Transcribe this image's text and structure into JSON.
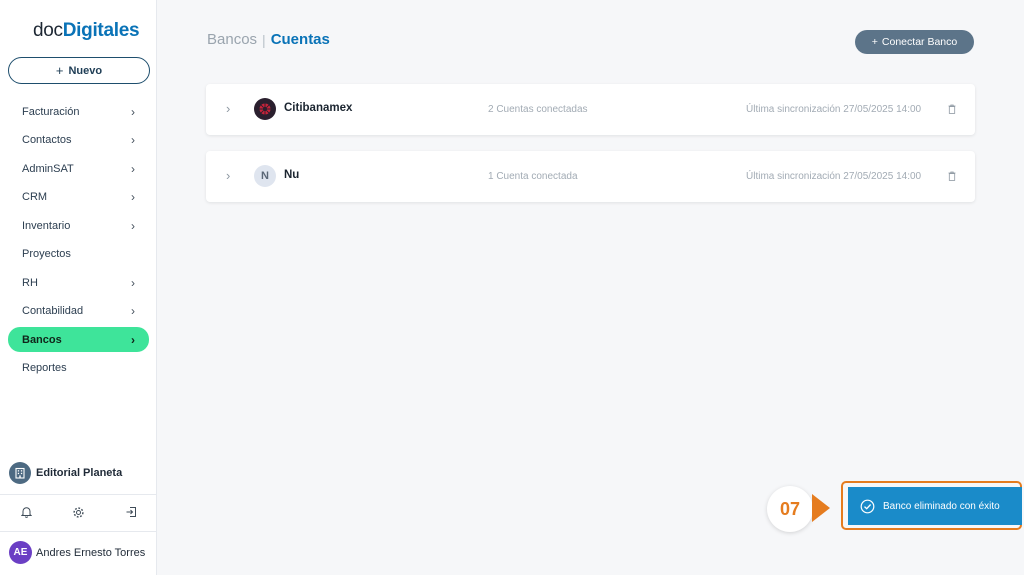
{
  "sidebar": {
    "logo": {
      "doc": "doc",
      "digitales": "Digitales"
    },
    "new_button": {
      "icon": "plus-icon",
      "label": "Nuevo"
    },
    "items": [
      {
        "label": "Facturación",
        "has_submenu": true,
        "active": false
      },
      {
        "label": "Contactos",
        "has_submenu": true,
        "active": false
      },
      {
        "label": "AdminSAT",
        "has_submenu": true,
        "active": false
      },
      {
        "label": "CRM",
        "has_submenu": true,
        "active": false
      },
      {
        "label": "Inventario",
        "has_submenu": true,
        "active": false
      },
      {
        "label": "Proyectos",
        "has_submenu": false,
        "active": false
      },
      {
        "label": "RH",
        "has_submenu": true,
        "active": false
      },
      {
        "label": "Contabilidad",
        "has_submenu": true,
        "active": false
      },
      {
        "label": "Bancos",
        "has_submenu": true,
        "active": true
      },
      {
        "label": "Reportes",
        "has_submenu": false,
        "active": false
      }
    ],
    "organization": {
      "name": "Editorial Planeta",
      "icon": "building-icon"
    },
    "bottom_icons": [
      "bell-icon",
      "gear-icon",
      "logout-icon"
    ],
    "user": {
      "initials": "AE",
      "name": "Andres Ernesto Torres"
    }
  },
  "header": {
    "breadcrumb_parent": "Bancos",
    "breadcrumb_separator": "|",
    "breadcrumb_current": "Cuentas",
    "connect_button": {
      "icon": "plus-icon",
      "label": "Conectar Banco"
    }
  },
  "banks": [
    {
      "name": "Citibanamex",
      "logo": "citibanamex-logo",
      "accounts": "2 Cuentas conectadas",
      "sync": "Última sincronización 27/05/2025 14:00"
    },
    {
      "name": "Nu",
      "logo_letter": "N",
      "accounts": "1 Cuenta conectada",
      "sync": "Última sincronización 27/05/2025 14:00"
    }
  ],
  "toast": {
    "step": "07",
    "message": "Banco eliminado con éxito",
    "icon": "check-circle-icon"
  },
  "colors": {
    "accent": "#0a73b7",
    "active_nav": "#3ee49a",
    "toast_bg": "#1a8bc9",
    "highlight": "#e57c1f",
    "button_bg": "#5c7489"
  }
}
